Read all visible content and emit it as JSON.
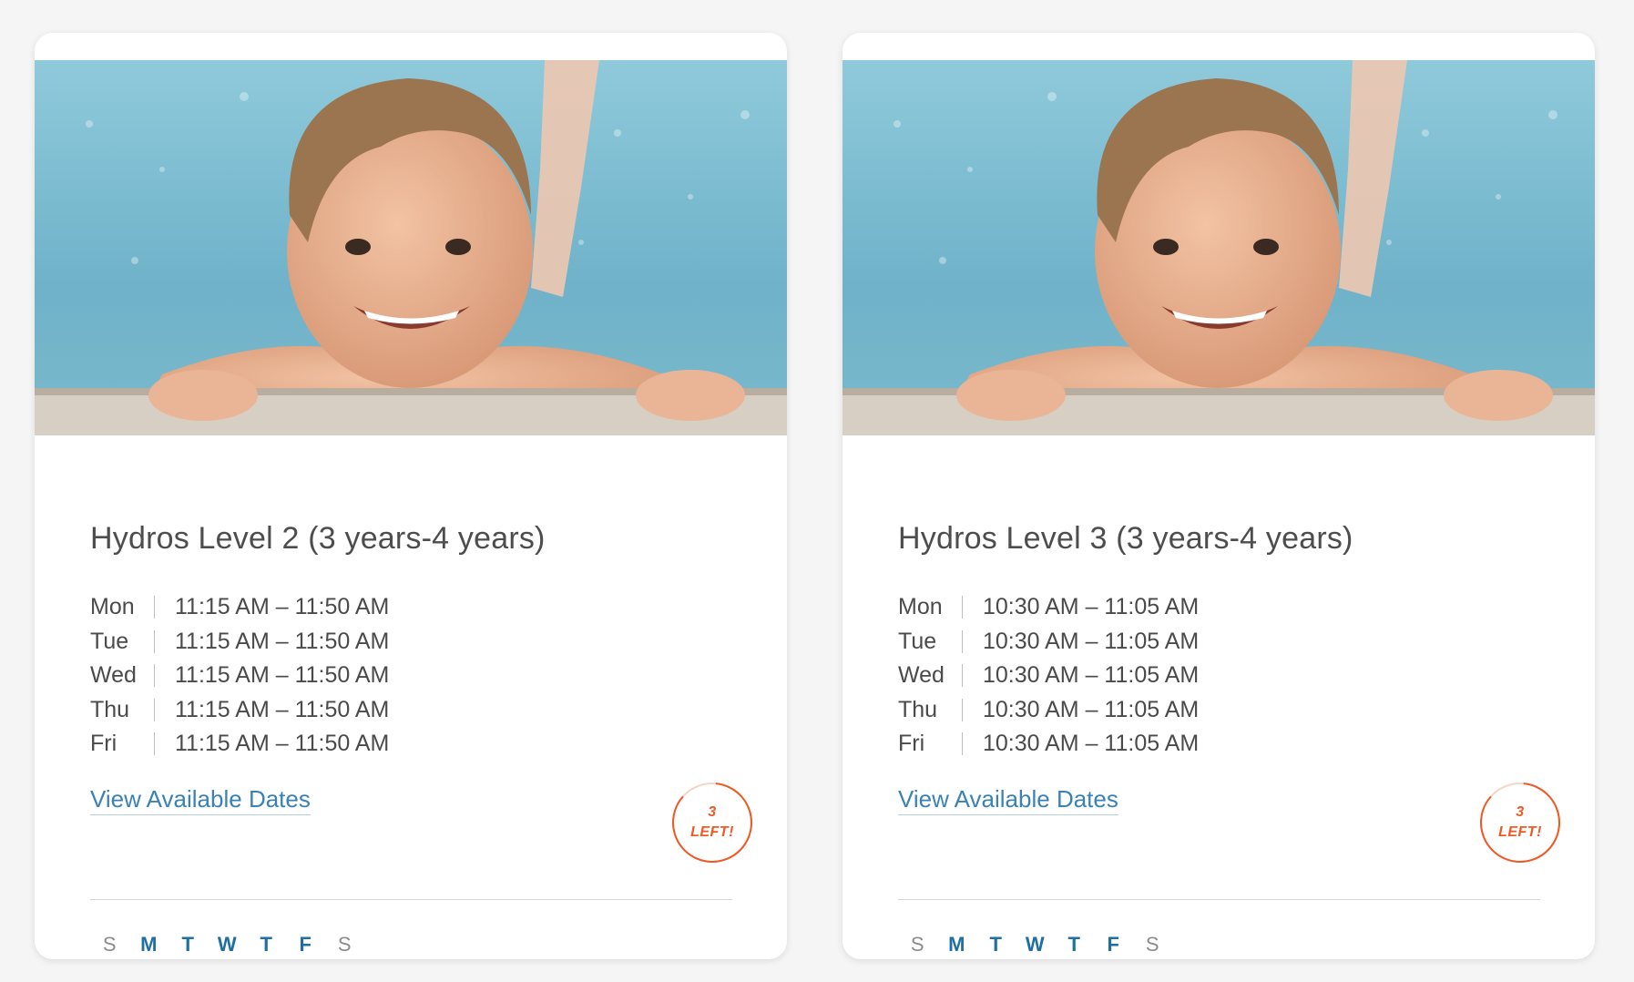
{
  "cards": [
    {
      "title": "Hydros Level 2 (3 years-4 years)",
      "schedule": [
        {
          "day": "Mon",
          "time": "11:15 AM – 11:50 AM"
        },
        {
          "day": "Tue",
          "time": "11:15 AM – 11:50 AM"
        },
        {
          "day": "Wed",
          "time": "11:15 AM – 11:50 AM"
        },
        {
          "day": "Thu",
          "time": "11:15 AM – 11:50 AM"
        },
        {
          "day": "Fri",
          "time": "11:15 AM – 11:50 AM"
        }
      ],
      "link_label": "View Available Dates",
      "badge": {
        "count": "3",
        "label": "LEFT!"
      },
      "weekdays": [
        {
          "letter": "S",
          "active": false
        },
        {
          "letter": "M",
          "active": true
        },
        {
          "letter": "T",
          "active": true
        },
        {
          "letter": "W",
          "active": true
        },
        {
          "letter": "T",
          "active": true
        },
        {
          "letter": "F",
          "active": true
        },
        {
          "letter": "S",
          "active": false
        }
      ]
    },
    {
      "title": "Hydros Level 3 (3 years-4 years)",
      "schedule": [
        {
          "day": "Mon",
          "time": "10:30 AM – 11:05 AM"
        },
        {
          "day": "Tue",
          "time": "10:30 AM – 11:05 AM"
        },
        {
          "day": "Wed",
          "time": "10:30 AM – 11:05 AM"
        },
        {
          "day": "Thu",
          "time": "10:30 AM – 11:05 AM"
        },
        {
          "day": "Fri",
          "time": "10:30 AM – 11:05 AM"
        }
      ],
      "link_label": "View Available Dates",
      "badge": {
        "count": "3",
        "label": "LEFT!"
      },
      "weekdays": [
        {
          "letter": "S",
          "active": false
        },
        {
          "letter": "M",
          "active": true
        },
        {
          "letter": "T",
          "active": true
        },
        {
          "letter": "W",
          "active": true
        },
        {
          "letter": "T",
          "active": true
        },
        {
          "letter": "F",
          "active": true
        },
        {
          "letter": "S",
          "active": false
        }
      ]
    }
  ],
  "colors": {
    "accent_blue": "#3a82b5",
    "weekday_active": "#1f6fa3",
    "badge_orange": "#ee5a24",
    "pool_water": "#7fbfd4"
  }
}
